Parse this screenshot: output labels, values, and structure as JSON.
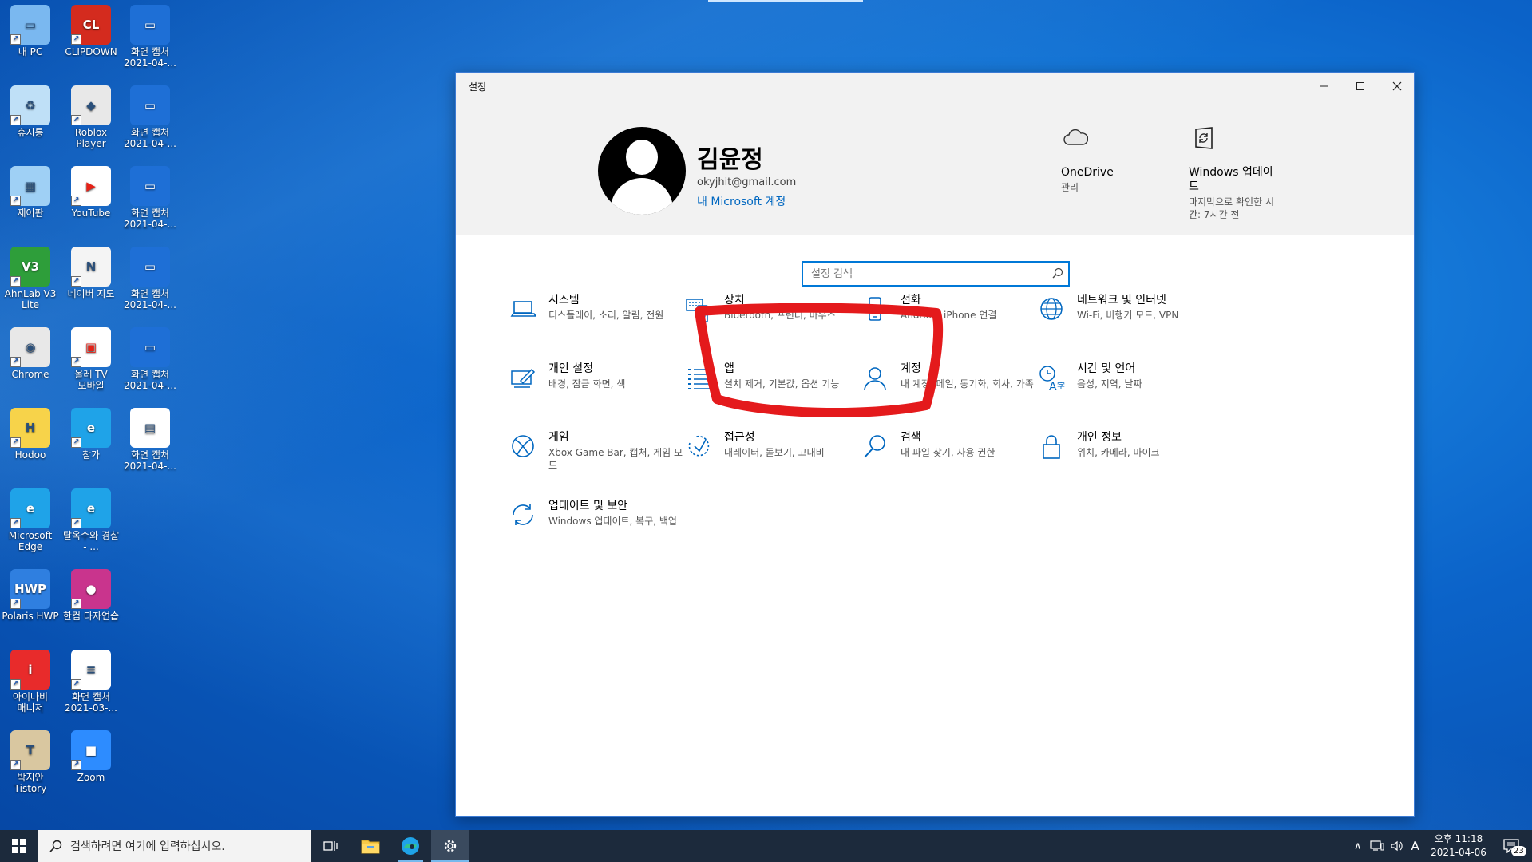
{
  "desktop": {
    "icons": [
      {
        "label": "내 PC",
        "icon": "computer-icon"
      },
      {
        "label": "CLIPDOWN",
        "icon": "clipdown-icon"
      },
      {
        "label": "화면 캡처 2021-04-...",
        "icon": "screenshot-icon"
      },
      {
        "label": "휴지통",
        "icon": "recycle-bin-icon"
      },
      {
        "label": "Roblox Player",
        "icon": "roblox-icon"
      },
      {
        "label": "화면 캡처 2021-04-...",
        "icon": "screenshot-icon"
      },
      {
        "label": "제어판",
        "icon": "control-panel-icon"
      },
      {
        "label": "YouTube",
        "icon": "youtube-icon"
      },
      {
        "label": "화면 캡처 2021-04-...",
        "icon": "screenshot-icon"
      },
      {
        "label": "AhnLab V3 Lite",
        "icon": "ahnlab-icon"
      },
      {
        "label": "네이버 지도",
        "icon": "naver-map-icon"
      },
      {
        "label": "화면 캡처 2021-04-...",
        "icon": "screenshot-icon"
      },
      {
        "label": "Chrome",
        "icon": "chrome-icon"
      },
      {
        "label": "올레 TV 모바일",
        "icon": "olleh-tv-icon"
      },
      {
        "label": "화면 캡처 2021-04-...",
        "icon": "screenshot-icon"
      },
      {
        "label": "Hodoo",
        "icon": "hodoo-icon"
      },
      {
        "label": "참가",
        "icon": "edge-icon"
      },
      {
        "label": "화면 캡처 2021-04-...",
        "icon": "image-file-icon"
      },
      {
        "label": "Microsoft Edge",
        "icon": "edge-icon"
      },
      {
        "label": "탈옥수와 경찰 - ...",
        "icon": "edge-icon"
      },
      {
        "label": "Polaris HWP",
        "icon": "hwp-icon"
      },
      {
        "label": "한컴 타자연습",
        "icon": "hancom-typing-icon"
      },
      {
        "label": "아이나비 매니저",
        "icon": "inavi-icon"
      },
      {
        "label": "화면 캡처 2021-03-...",
        "icon": "document-icon"
      },
      {
        "label": "박지안 Tistory",
        "icon": "tistory-icon"
      },
      {
        "label": "Zoom",
        "icon": "zoom-icon"
      }
    ]
  },
  "window": {
    "title": "설정",
    "controls": {
      "minimize": "—",
      "maximize": "☐",
      "close": "✕"
    }
  },
  "account": {
    "name": "김윤정",
    "email": "okyjhit@gmail.com",
    "link": "내 Microsoft 계정"
  },
  "header_items": [
    {
      "title": "OneDrive",
      "sub": "관리",
      "icon": "cloud-icon"
    },
    {
      "title": "Windows 업데이트",
      "sub": "마지막으로 확인한 시간: 7시간 전",
      "icon": "update-icon"
    }
  ],
  "search": {
    "placeholder": "설정 검색"
  },
  "categories": [
    {
      "title": "시스템",
      "sub": "디스플레이, 소리, 알림, 전원",
      "icon": "laptop-icon"
    },
    {
      "title": "장치",
      "sub": "Bluetooth, 프린터, 마우스",
      "icon": "keyboard-speaker-icon"
    },
    {
      "title": "전화",
      "sub": "Android, iPhone 연결",
      "icon": "phone-icon"
    },
    {
      "title": "네트워크 및 인터넷",
      "sub": "Wi-Fi, 비행기 모드, VPN",
      "icon": "globe-icon"
    },
    {
      "title": "개인 설정",
      "sub": "배경, 잠금 화면, 색",
      "icon": "paint-brush-icon"
    },
    {
      "title": "앱",
      "sub": "설치 제거, 기본값, 옵션 기능",
      "icon": "apps-list-icon"
    },
    {
      "title": "계정",
      "sub": "내 계정, 메일, 동기화, 회사, 가족",
      "icon": "person-icon"
    },
    {
      "title": "시간 및 언어",
      "sub": "음성, 지역, 날짜",
      "icon": "time-language-icon"
    },
    {
      "title": "게임",
      "sub": "Xbox Game Bar, 캡처, 게임 모드",
      "icon": "xbox-icon"
    },
    {
      "title": "접근성",
      "sub": "내레이터, 돋보기, 고대비",
      "icon": "ease-of-access-icon"
    },
    {
      "title": "검색",
      "sub": "내 파일 찾기, 사용 권한",
      "icon": "magnifier-icon"
    },
    {
      "title": "개인 정보",
      "sub": "위치, 카메라, 마이크",
      "icon": "lock-icon"
    },
    {
      "title": "업데이트 및 보안",
      "sub": "Windows 업데이트, 복구, 백업",
      "icon": "sync-icon"
    }
  ],
  "taskbar": {
    "search_placeholder": "검색하려면 여기에 입력하십시오.",
    "ime": "A",
    "time": "오후 11:18",
    "date": "2021-04-06",
    "notifications": "23"
  }
}
